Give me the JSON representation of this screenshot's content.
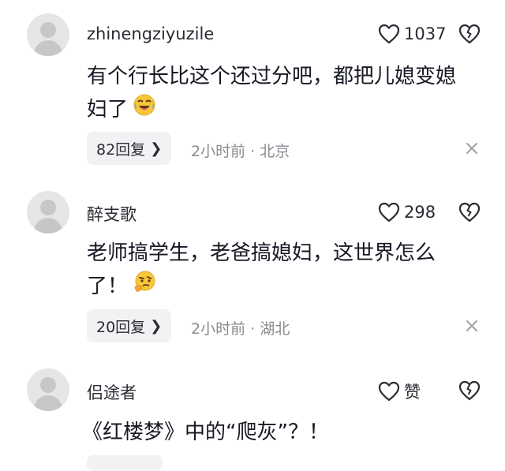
{
  "comments": [
    {
      "username": "zhinengziyuzile",
      "likes": "1037",
      "text": "有个行长比这个还过分吧，都把儿媳变媳妇了",
      "emoji": "laughing-crying-emoji",
      "replies": "82回复",
      "meta": "2小时前 · 北京"
    },
    {
      "username": "醉支歌",
      "likes": "298",
      "text": "老师搞学生，老爸搞媳妇，这世界怎么了！",
      "emoji": "thinking-face-emoji",
      "replies": "20回复",
      "meta": "2小时前 · 湖北"
    },
    {
      "username": "侣途者",
      "likes": "赞",
      "text": "《红楼梦》中的“爬灰”？！"
    }
  ],
  "icons": {
    "like": "heart-icon",
    "dislike": "broken-heart-icon",
    "close": "close-icon",
    "reply_chevron": "chevron-right-icon"
  },
  "colors": {
    "text": "#161823",
    "muted": "#8a8b91",
    "pill_bg": "#f2f2f4",
    "avatar_bg": "#e6e6e8"
  }
}
